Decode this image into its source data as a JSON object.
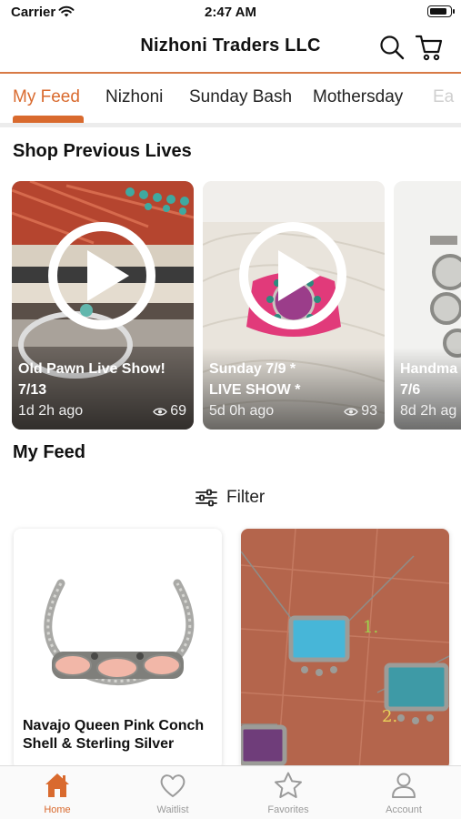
{
  "status_bar": {
    "carrier": "Carrier",
    "time": "2:47 AM",
    "battery_level": 0.85
  },
  "header": {
    "title": "Nizhoni Traders LLC",
    "search_icon": "search-icon",
    "cart_icon": "cart-icon"
  },
  "tabs": [
    {
      "label": "My Feed",
      "active": true
    },
    {
      "label": "Nizhoni",
      "active": false
    },
    {
      "label": "Sunday Bash",
      "active": false
    },
    {
      "label": "Mothersday",
      "active": false
    },
    {
      "label": "Ea",
      "active": false
    }
  ],
  "previous_lives": {
    "title": "Shop Previous Lives",
    "items": [
      {
        "title": "Old Pawn Live Show!\n7/13",
        "age": "1d 2h ago",
        "views": "69"
      },
      {
        "title": "Sunday 7/9 *\nLIVE SHOW *",
        "age": "5d 0h ago",
        "views": "93"
      },
      {
        "title": "Handma\n7/6",
        "age": "8d 2h ag",
        "views": ""
      }
    ]
  },
  "feed": {
    "title": "My Feed",
    "filter_label": "Filter",
    "items": [
      {
        "title": "Navajo Queen Pink Conch Shell & Sterling Silver"
      },
      {
        "title": "",
        "labels": [
          "1.",
          "2."
        ]
      }
    ]
  },
  "bottom_nav": [
    {
      "label": "Home",
      "icon": "home-icon",
      "active": true
    },
    {
      "label": "Waitlist",
      "icon": "heart-icon",
      "active": false
    },
    {
      "label": "Favorites",
      "icon": "star-icon",
      "active": false
    },
    {
      "label": "Account",
      "icon": "person-icon",
      "active": false
    }
  ],
  "colors": {
    "accent": "#d96a2e",
    "header_rule": "#d87a45",
    "inactive_nav": "#9a9a9a"
  }
}
